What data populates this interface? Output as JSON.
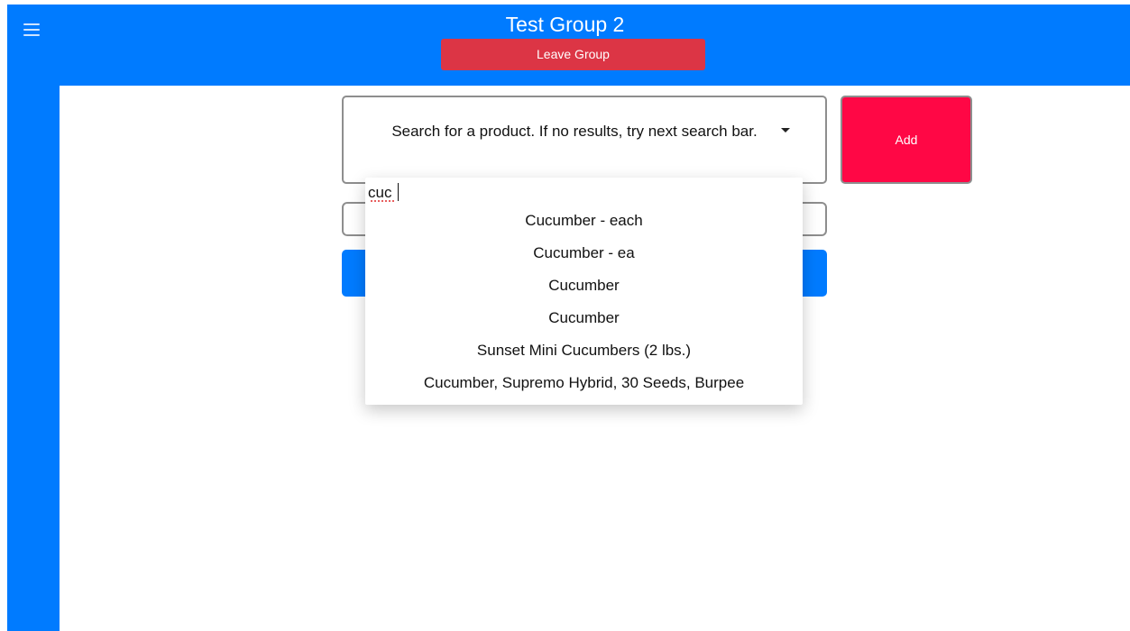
{
  "header": {
    "title": "Test Group 2",
    "leave_label": "Leave Group",
    "menu_icon": "hamburger-menu-icon"
  },
  "search": {
    "placeholder": "Search for a product. If no results, try next search bar.",
    "query": "cuc",
    "options": [
      "Cucumber - each",
      "Cucumber - ea",
      "Cucumber",
      "Cucumber",
      "Sunset Mini Cucumbers (2 lbs.)",
      "Cucumber, Supremo Hybrid, 30 Seeds, Burpee"
    ]
  },
  "actions": {
    "add_label": "Add"
  },
  "colors": {
    "primary": "#007bff",
    "danger": "#dc3545",
    "add": "#ff0745"
  }
}
